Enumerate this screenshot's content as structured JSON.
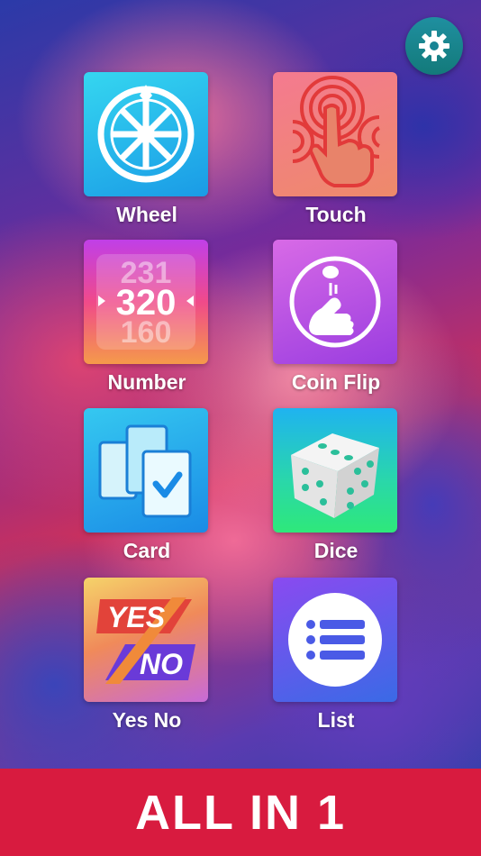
{
  "settings": {
    "icon": "gear-icon"
  },
  "tiles": [
    {
      "label": "Wheel",
      "icon": "wheel-icon"
    },
    {
      "label": "Touch",
      "icon": "touch-icon"
    },
    {
      "label": "Number",
      "icon": "number-icon",
      "numbers": [
        "231",
        "320",
        "160"
      ]
    },
    {
      "label": "Coin Flip",
      "icon": "coin-flip-icon"
    },
    {
      "label": "Card",
      "icon": "card-icon"
    },
    {
      "label": "Dice",
      "icon": "dice-icon"
    },
    {
      "label": "Yes No",
      "icon": "yes-no-icon",
      "words": [
        "YES",
        "NO"
      ]
    },
    {
      "label": "List",
      "icon": "list-icon"
    }
  ],
  "banner": {
    "text": "ALL IN 1"
  },
  "colors": {
    "banner": "#d81b3f",
    "settings": "#1f8fa0"
  }
}
